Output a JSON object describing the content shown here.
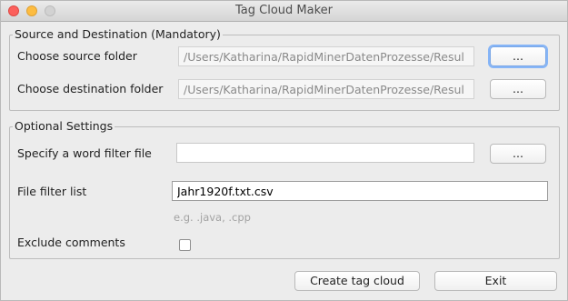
{
  "window": {
    "title": "Tag Cloud Maker"
  },
  "source_dest": {
    "legend": "Source and Destination (Mandatory)",
    "source_label": "Choose source folder",
    "source_value": "/Users/Katharina/RapidMinerDatenProzesse/Resul",
    "dest_label": "Choose destination folder",
    "dest_value": "/Users/Katharina/RapidMinerDatenProzesse/Resul",
    "browse_label": "..."
  },
  "optional": {
    "legend": "Optional Settings",
    "word_filter_label": "Specify a word filter file",
    "word_filter_value": "",
    "file_filter_label": "File filter list",
    "file_filter_value": "Jahr1920f.txt.csv",
    "file_filter_hint": "e.g. .java, .cpp",
    "exclude_label": "Exclude comments",
    "exclude_checked": false
  },
  "actions": {
    "create_label": "Create tag cloud",
    "exit_label": "Exit"
  }
}
